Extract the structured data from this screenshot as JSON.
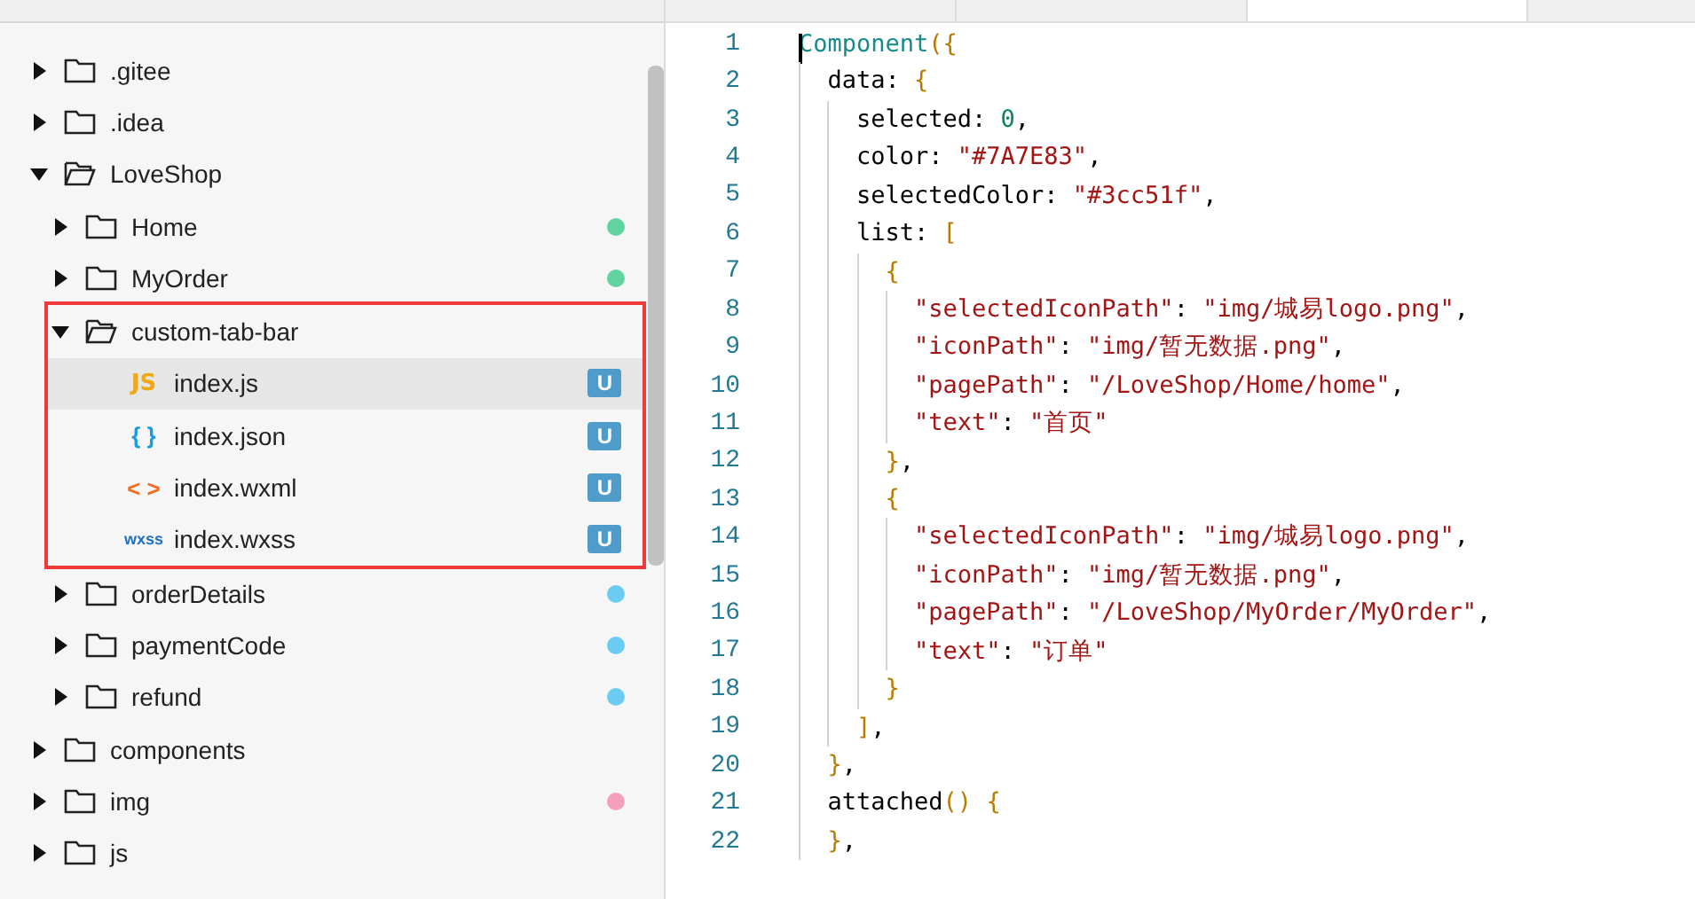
{
  "editor_tabs": [
    {
      "selected": false
    },
    {
      "selected": false
    },
    {
      "selected": true
    }
  ],
  "file_tree": [
    {
      "name": ".gitee",
      "kind": "folder",
      "expanded": false,
      "selected": false
    },
    {
      "name": ".idea",
      "kind": "folder",
      "expanded": false,
      "selected": false
    },
    {
      "name": "LoveShop",
      "kind": "folder",
      "expanded": true,
      "selected": false,
      "children": [
        {
          "name": "Home",
          "kind": "folder",
          "expanded": false,
          "selected": false,
          "color": "#5fd3a0"
        },
        {
          "name": "MyOrder",
          "kind": "folder",
          "expanded": false,
          "selected": false,
          "color": "#5fd3a0"
        },
        {
          "name": "custom-tab-bar",
          "kind": "folder",
          "expanded": true,
          "selected": false,
          "highlighted": true,
          "children": [
            {
              "name": "index.js",
              "kind": "js",
              "selected": true,
              "badge": "U"
            },
            {
              "name": "index.json",
              "kind": "json",
              "selected": false,
              "badge": "U"
            },
            {
              "name": "index.wxml",
              "kind": "wxml",
              "selected": false,
              "badge": "U"
            },
            {
              "name": "index.wxss",
              "kind": "wxss",
              "selected": false,
              "badge": "U"
            }
          ]
        },
        {
          "name": "orderDetails",
          "kind": "folder",
          "expanded": false,
          "selected": false,
          "color": "#6ccbf2"
        },
        {
          "name": "paymentCode",
          "kind": "folder",
          "expanded": false,
          "selected": false,
          "color": "#6ccbf2"
        },
        {
          "name": "refund",
          "kind": "folder",
          "expanded": false,
          "selected": false,
          "color": "#6ccbf2"
        }
      ]
    },
    {
      "name": "components",
      "kind": "folder",
      "expanded": false,
      "selected": false
    },
    {
      "name": "img",
      "kind": "folder",
      "expanded": false,
      "selected": false,
      "color": "#f4a0bd"
    },
    {
      "name": "js",
      "kind": "folder",
      "expanded": false,
      "selected": false
    }
  ],
  "file_icon_labels": {
    "js": "JS",
    "json": "{ }",
    "wxml": "< >",
    "wxss": "wxss"
  },
  "code_lines": [
    {
      "number": "1",
      "text": "Component({"
    },
    {
      "number": "2",
      "text": "  data: {"
    },
    {
      "number": "3",
      "text": "    selected: 0,"
    },
    {
      "number": "4",
      "text": "    color: \"#7A7E83\","
    },
    {
      "number": "5",
      "text": "    selectedColor: \"#3cc51f\","
    },
    {
      "number": "6",
      "text": "    list: ["
    },
    {
      "number": "7",
      "text": "      {"
    },
    {
      "number": "8",
      "text": "        \"selectedIconPath\": \"img/城易logo.png\","
    },
    {
      "number": "9",
      "text": "        \"iconPath\": \"img/暂无数据.png\","
    },
    {
      "number": "10",
      "text": "        \"pagePath\": \"/LoveShop/Home/home\","
    },
    {
      "number": "11",
      "text": "        \"text\": \"首页\""
    },
    {
      "number": "12",
      "text": "      },"
    },
    {
      "number": "13",
      "text": "      {"
    },
    {
      "number": "14",
      "text": "        \"selectedIconPath\": \"img/城易logo.png\","
    },
    {
      "number": "15",
      "text": "        \"iconPath\": \"img/暂无数据.png\","
    },
    {
      "number": "16",
      "text": "        \"pagePath\": \"/LoveShop/MyOrder/MyOrder\","
    },
    {
      "number": "17",
      "text": "        \"text\": \"订单\""
    },
    {
      "number": "18",
      "text": "      }"
    },
    {
      "number": "19",
      "text": "    ],"
    },
    {
      "number": "20",
      "text": "  },"
    },
    {
      "number": "21",
      "text": "  attached() {"
    },
    {
      "number": "22",
      "text": "  },"
    }
  ]
}
